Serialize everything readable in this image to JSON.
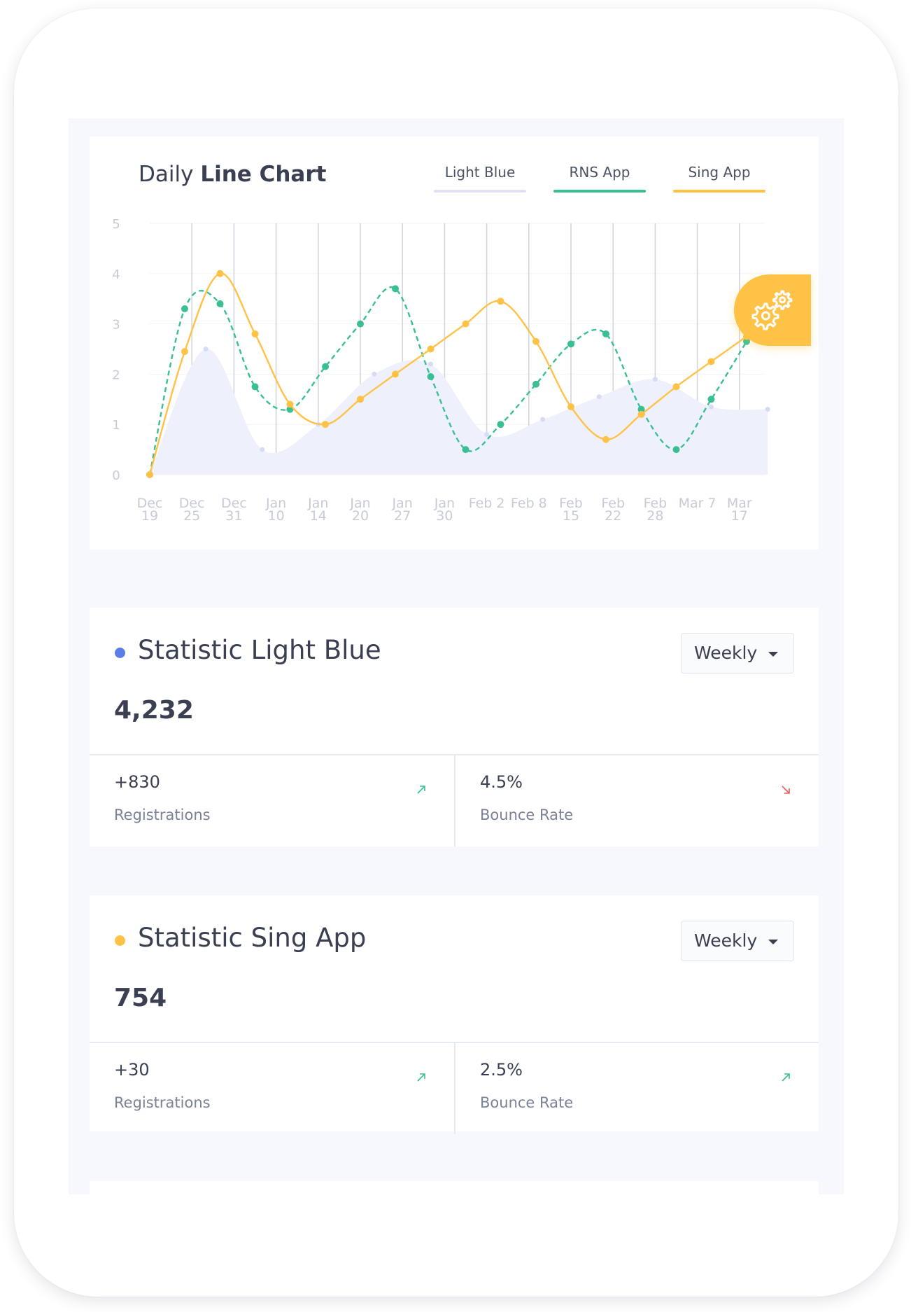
{
  "chart_card": {
    "title_regular": "Daily",
    "title_bold": "Line Chart"
  },
  "legend": [
    {
      "label": "Light Blue",
      "color": "#e3e1f5"
    },
    {
      "label": "RNS App",
      "color": "#3abf94"
    },
    {
      "label": "Sing App",
      "color": "#ffc247"
    }
  ],
  "settings_button": {
    "icon": "gears-icon",
    "color": "#fec246"
  },
  "chart_data": {
    "type": "line",
    "title": "Daily Line Chart",
    "xlabel": "",
    "ylabel": "",
    "ylim": [
      0,
      5
    ],
    "yticks": [
      0,
      1,
      2,
      3,
      4,
      5
    ],
    "grid": "vertical lines at each category",
    "x_tick_labels": [
      [
        "Dec",
        "19"
      ],
      [
        "Dec",
        "25"
      ],
      [
        "Dec",
        "31"
      ],
      [
        "Jan",
        "10"
      ],
      [
        "Jan",
        "14"
      ],
      [
        "Jan",
        "20"
      ],
      [
        "Jan",
        "27"
      ],
      [
        "Jan",
        "30"
      ],
      [
        "Feb 2"
      ],
      [
        "Feb 8"
      ],
      [
        "Feb",
        "15"
      ],
      [
        "Feb",
        "22"
      ],
      [
        "Feb",
        "28"
      ],
      [
        "Mar 7"
      ],
      [
        "Mar",
        "17"
      ]
    ],
    "categories": [
      "Dec 19",
      "Dec 25",
      "Dec 31",
      "Jan 10",
      "Jan 14",
      "Jan 20",
      "Jan 27",
      "Jan 30",
      "Feb 2",
      "Feb 8",
      "Feb 15",
      "Feb 22",
      "Feb 28",
      "Mar 7",
      "Mar 17"
    ],
    "series": [
      {
        "name": "Light Blue",
        "style": "area",
        "color": "#d6dcf8",
        "x": [
          0,
          1.33,
          2.67,
          4,
          5.33,
          6.67,
          8,
          9.33,
          10.67,
          12,
          13.33,
          14.67
        ],
        "values": [
          0.0,
          2.5,
          0.5,
          1.0,
          2.0,
          2.2,
          0.8,
          1.1,
          1.55,
          1.9,
          1.35,
          1.3
        ]
      },
      {
        "name": "RNS App",
        "style": "dashed",
        "color": "#3abf94",
        "x": [
          0,
          0.83,
          1.67,
          2.5,
          3.33,
          4.17,
          5,
          5.83,
          6.67,
          7.5,
          8.33,
          9.17,
          10,
          10.83,
          11.67,
          12.5,
          13.33,
          14.17
        ],
        "values": [
          0.0,
          3.3,
          3.4,
          1.75,
          1.3,
          2.15,
          3.0,
          3.7,
          1.95,
          0.5,
          1.0,
          1.8,
          2.6,
          2.8,
          1.3,
          0.5,
          1.5,
          2.65
        ]
      },
      {
        "name": "Sing App",
        "style": "solid",
        "color": "#ffc247",
        "x": [
          0,
          0.83,
          1.67,
          2.5,
          3.33,
          4.17,
          5,
          5.83,
          6.67,
          7.5,
          8.33,
          9.17,
          10,
          10.83,
          11.67,
          12.5,
          13.33,
          14.17
        ],
        "values": [
          0.0,
          2.45,
          4.0,
          2.8,
          1.4,
          1.0,
          1.5,
          2.0,
          2.5,
          3.0,
          3.45,
          2.65,
          1.35,
          0.7,
          1.2,
          1.75,
          2.25,
          2.75
        ]
      }
    ]
  },
  "statistics": [
    {
      "title": "Statistic Light Blue",
      "dot_color": "#5b7de8",
      "period": "Weekly",
      "value": "4,232",
      "metrics": [
        {
          "value": "+830",
          "label": "Registrations",
          "trend": "up",
          "trend_color": "#3abf94",
          "icon": "arrow-up-right-icon"
        },
        {
          "value": "4.5%",
          "label": "Bounce Rate",
          "trend": "down",
          "trend_color": "#f45a5a",
          "icon": "arrow-down-right-icon"
        }
      ]
    },
    {
      "title": "Statistic Sing App",
      "dot_color": "#ffc247",
      "period": "Weekly",
      "value": "754",
      "metrics": [
        {
          "value": "+30",
          "label": "Registrations",
          "trend": "up",
          "trend_color": "#3abf94",
          "icon": "arrow-up-right-icon"
        },
        {
          "value": "2.5%",
          "label": "Bounce Rate",
          "trend": "up",
          "trend_color": "#3abf94",
          "icon": "arrow-up-right-icon"
        }
      ]
    }
  ]
}
